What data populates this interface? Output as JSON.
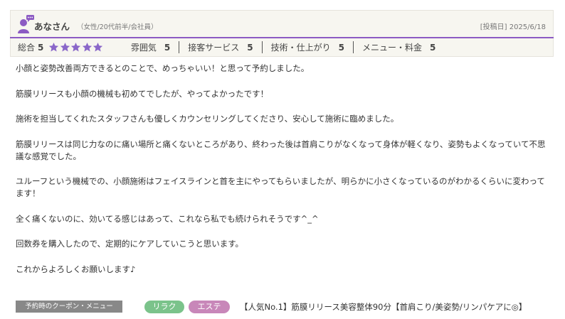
{
  "reviewer": {
    "name": "あなさん",
    "profile": "（女性/20代前半/会社員）",
    "posted": "[投稿日] 2025/6/18"
  },
  "ratings": {
    "overall_label": "総合",
    "overall_value": "5",
    "stars_filled": 5,
    "star_color": "#8a67c9",
    "categories": [
      {
        "label": "雰囲気",
        "value": "5"
      },
      {
        "label": "接客サービス",
        "value": "5"
      },
      {
        "label": "技術・仕上がり",
        "value": "5"
      },
      {
        "label": "メニュー・料金",
        "value": "5"
      }
    ]
  },
  "review": {
    "paragraphs": [
      "小顔と姿勢改善両方できるとのことで、めっちゃいい！と思って予約しました。",
      "筋膜リリースも小顔の機械も初めてでしたが、やってよかったです！",
      "施術を担当してくれたスタッフさんも優しくカウンセリングしてくださり、安心して施術に臨めました。",
      "筋膜リリースは同じ力なのに痛い場所と痛くないところがあり、終わった後は首肩こりがなくなって身体が軽くなり、姿勢もよくなっていて不思議な感覚でした。",
      "ユルーフという機械での、小顔施術はフェイスラインと首を主にやってもらいましたが、明らかに小さくなっているのがわかるくらいに変わってます！",
      "全く痛くないのに、効いてる感じはあって、これなら私でも続けられそうです^_^",
      "回数券を購入したので、定期的にケアしていこうと思います。",
      "これからよろしくお願いします♪"
    ]
  },
  "coupon": {
    "label": "予約時のクーポン・メニュー",
    "tags": [
      "リラク",
      "エステ"
    ],
    "menu": "【人気No.1】筋膜リリース美容整体90分【首肩こり/美姿勢/リンパケアに◎】"
  },
  "colors": {
    "accent_purple": "#8c5bc3",
    "tag_riraku": "#7bc38b",
    "tag_esute": "#c887b9"
  }
}
